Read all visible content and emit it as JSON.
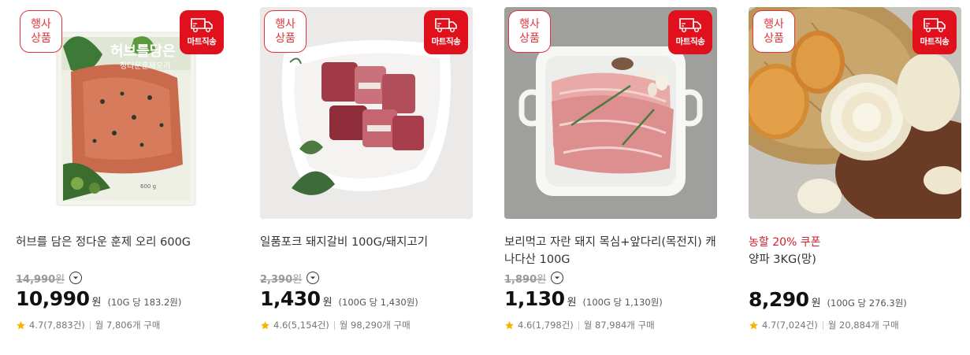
{
  "badges": {
    "event_line1": "행사",
    "event_line2": "상품",
    "mart": "마트직송"
  },
  "products": [
    {
      "coupon": "",
      "title": "허브를 담은 정다운 훈제 오리 600G",
      "original_price": "14,990",
      "original_unit": "원",
      "price": "10,990",
      "currency": "원",
      "unit_price": "(10G 당 183.2원)",
      "rating": "4.7",
      "reviews": "(7,883건)",
      "purchases": "월 7,806개 구매",
      "package_text_1": "허브를담은",
      "package_text_2": "정다운훈제오리",
      "package_text_3": "600 g"
    },
    {
      "coupon": "",
      "title": "일품포크 돼지갈비 100G/돼지고기",
      "original_price": "2,390",
      "original_unit": "원",
      "price": "1,430",
      "currency": "원",
      "unit_price": "(100G 당 1,430원)",
      "rating": "4.6",
      "reviews": "(5,154건)",
      "purchases": "월 98,290개 구매"
    },
    {
      "coupon": "",
      "title": "보리먹고 자란 돼지 목심+앞다리(목전지) 캐나다산 100G",
      "original_price": "1,890",
      "original_unit": "원",
      "price": "1,130",
      "currency": "원",
      "unit_price": "(100G 당 1,130원)",
      "rating": "4.6",
      "reviews": "(1,798건)",
      "purchases": "월 87,984개 구매"
    },
    {
      "coupon": "농할 20% 쿠폰",
      "title": "양파 3KG(망)",
      "original_price": "",
      "original_unit": "",
      "price": "8,290",
      "currency": "원",
      "unit_price": "(100G 당 276.3원)",
      "rating": "4.7",
      "reviews": "(7,024건)",
      "purchases": "월 20,884개 구매"
    }
  ],
  "colors": {
    "accent_red": "#e0101d",
    "coupon_red": "#d31d2a",
    "star": "#f5b400"
  },
  "icons": {
    "truck": "delivery-truck-icon",
    "star": "star-icon",
    "info": "chevron-down-circle-icon"
  }
}
